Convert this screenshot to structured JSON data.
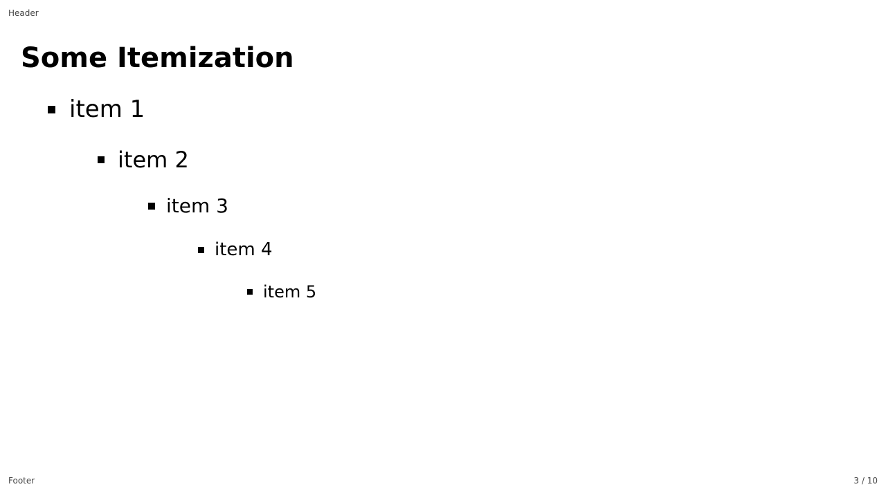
{
  "header": {
    "text": "Header"
  },
  "footer": {
    "text": "Footer"
  },
  "page_number": {
    "text": "3 / 10"
  },
  "slide": {
    "title": "Some Itemization",
    "items": [
      {
        "label": "item 1",
        "level": 1
      },
      {
        "label": "item 2",
        "level": 2
      },
      {
        "label": "item 3",
        "level": 3
      },
      {
        "label": "item 4",
        "level": 4
      },
      {
        "label": "item 5",
        "level": 5
      }
    ]
  },
  "icons": {
    "bullet": "square-bullet-icon"
  },
  "colors": {
    "text": "#000000",
    "background": "#ffffff",
    "muted": "#444444"
  }
}
